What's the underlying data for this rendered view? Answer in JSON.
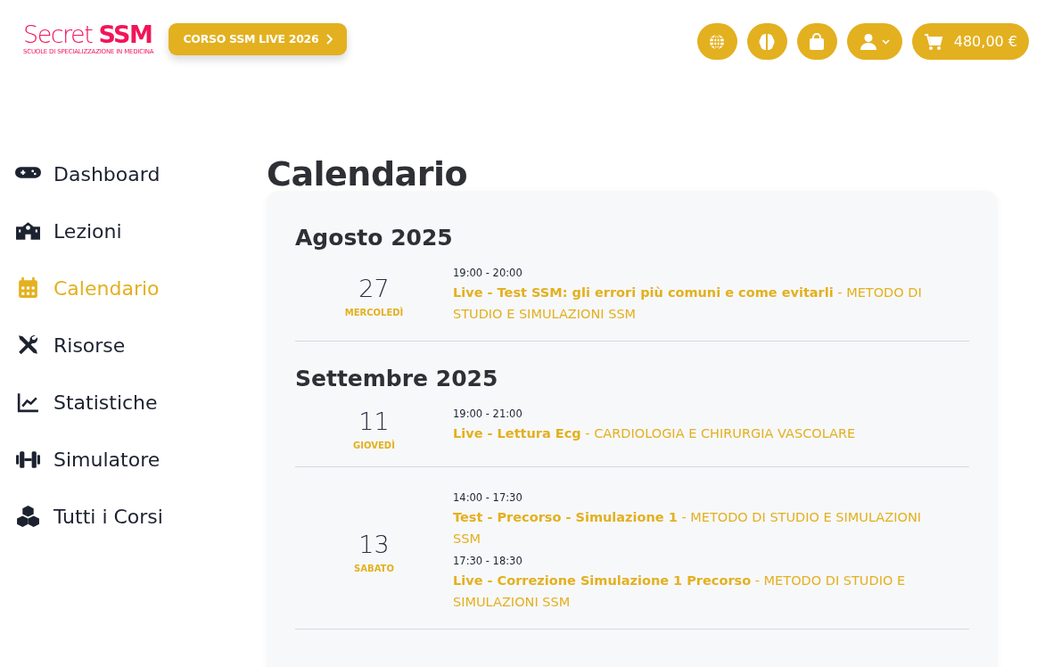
{
  "header": {
    "logo": {
      "name": "Secret **SSM**",
      "tagline": "SCUOLE DI SPECIALIZZAZIONE IN MEDICINA"
    },
    "promo_button": "CORSO SSM LIVE 2026",
    "cart_total": "480,00 €"
  },
  "sidebar": {
    "items": [
      {
        "label": "Dashboard",
        "selected": false
      },
      {
        "label": "Lezioni",
        "selected": false
      },
      {
        "label": "Calendario",
        "selected": true
      },
      {
        "label": "Risorse",
        "selected": false
      },
      {
        "label": "Statistiche",
        "selected": false
      },
      {
        "label": "Simulatore",
        "selected": false
      },
      {
        "label": "Tutti i Corsi",
        "selected": false
      }
    ]
  },
  "page_title": "Calendario",
  "months": [
    {
      "title": "Agosto 2025",
      "days": [
        {
          "day": "27",
          "weekday": "MERCOLEDÌ",
          "events": [
            {
              "time": "19:00 - 20:00",
              "text": "**Live - Test SSM: gli errori più comuni e come evitarli** - METODO DI STUDIO E SIMULAZIONI SSM"
            }
          ]
        }
      ]
    },
    {
      "title": "Settembre 2025",
      "days": [
        {
          "day": "11",
          "weekday": "GIOVEDÌ",
          "events": [
            {
              "time": "19:00 - 21:00",
              "text": "**Live - Lettura Ecg** - CARDIOLOGIA E CHIRURGIA VASCOLARE"
            }
          ]
        },
        {
          "day": "13",
          "weekday": "SABATO",
          "events": [
            {
              "time": "14:00 - 17:30",
              "text": "**Test - Precorso - Simulazione 1** - METODO DI STUDIO E SIMULAZIONI SSM"
            },
            {
              "time": "17:30 - 18:30",
              "text": "**Live - Correzione Simulazione 1 Precorso** - METODO DI STUDIO E SIMULAZIONI SSM"
            }
          ]
        }
      ]
    }
  ]
}
